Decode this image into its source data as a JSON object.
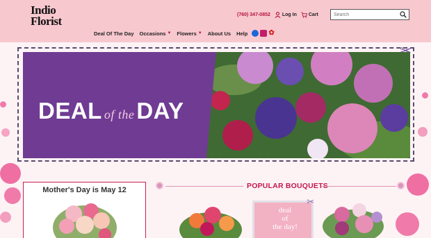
{
  "header": {
    "logo_line1": "Indio",
    "logo_line2": "Florist",
    "phone": "(760) 347-0852",
    "login_label": "Log In",
    "cart_label": "Cart",
    "search_placeholder": "Search"
  },
  "nav": {
    "items": [
      {
        "label": "Deal Of The Day"
      },
      {
        "label": "Occasions"
      },
      {
        "label": "Flowers"
      },
      {
        "label": "About Us"
      },
      {
        "label": "Help"
      }
    ]
  },
  "banner": {
    "word1": "DEAL",
    "word2": "of the",
    "word3": "DAY"
  },
  "promo": {
    "mothers_day": "Mother's Day is May 12"
  },
  "popular": {
    "heading": "POPULAR BOUQUETS",
    "card_line1": "deal",
    "card_line2": "of",
    "card_line3": "the day!"
  },
  "colors": {
    "header_bg": "#f8c8cf",
    "accent": "#c5184f",
    "banner_purple": "#6f3b93"
  }
}
